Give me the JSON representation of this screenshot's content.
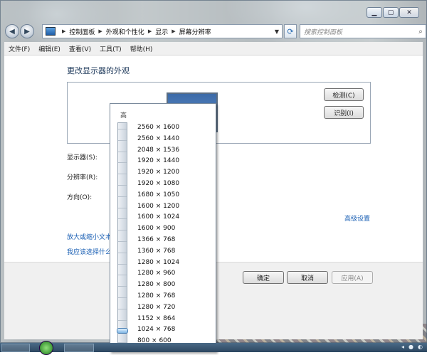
{
  "window": {
    "caption_buttons": [
      "minimize",
      "maximize",
      "close"
    ]
  },
  "breadcrumb": [
    "控制面板",
    "外观和个性化",
    "显示",
    "屏幕分辨率"
  ],
  "search": {
    "placeholder": "搜索控制面板"
  },
  "menu": [
    "文件(F)",
    "编辑(E)",
    "查看(V)",
    "工具(T)",
    "帮助(H)"
  ],
  "main": {
    "heading": "更改显示器的外观",
    "detect_button": "检测(C)",
    "identify_button": "识别(I)",
    "display_label": "显示器(S):",
    "resolution_label": "分辨率(R):",
    "orientation_label": "方向(O):",
    "advanced_link": "高级设置",
    "text_size_link": "放大或缩小文本",
    "which_settings_link": "我应该选择什么"
  },
  "footer": {
    "ok": "确定",
    "cancel": "取消",
    "apply": "应用(A)"
  },
  "dropdown": {
    "high_label": "高",
    "resolutions": [
      "2560 × 1600",
      "2560 × 1440",
      "2048 × 1536",
      "1920 × 1440",
      "1920 × 1200",
      "1920 × 1080",
      "1680 × 1050",
      "1600 × 1200",
      "1600 × 1024",
      "1600 × 900",
      "1366 × 768",
      "1360 × 768",
      "1280 × 1024",
      "1280 × 960",
      "1280 × 800",
      "1280 × 768",
      "1280 × 720",
      "1152 × 864",
      "1024 × 768",
      "800 × 600"
    ],
    "selected": "1024 × 768"
  },
  "icons": [
    "back-icon",
    "forward-icon",
    "folder-icon",
    "refresh-icon",
    "search-icon",
    "monitor-icon",
    "start-orb-icon"
  ]
}
